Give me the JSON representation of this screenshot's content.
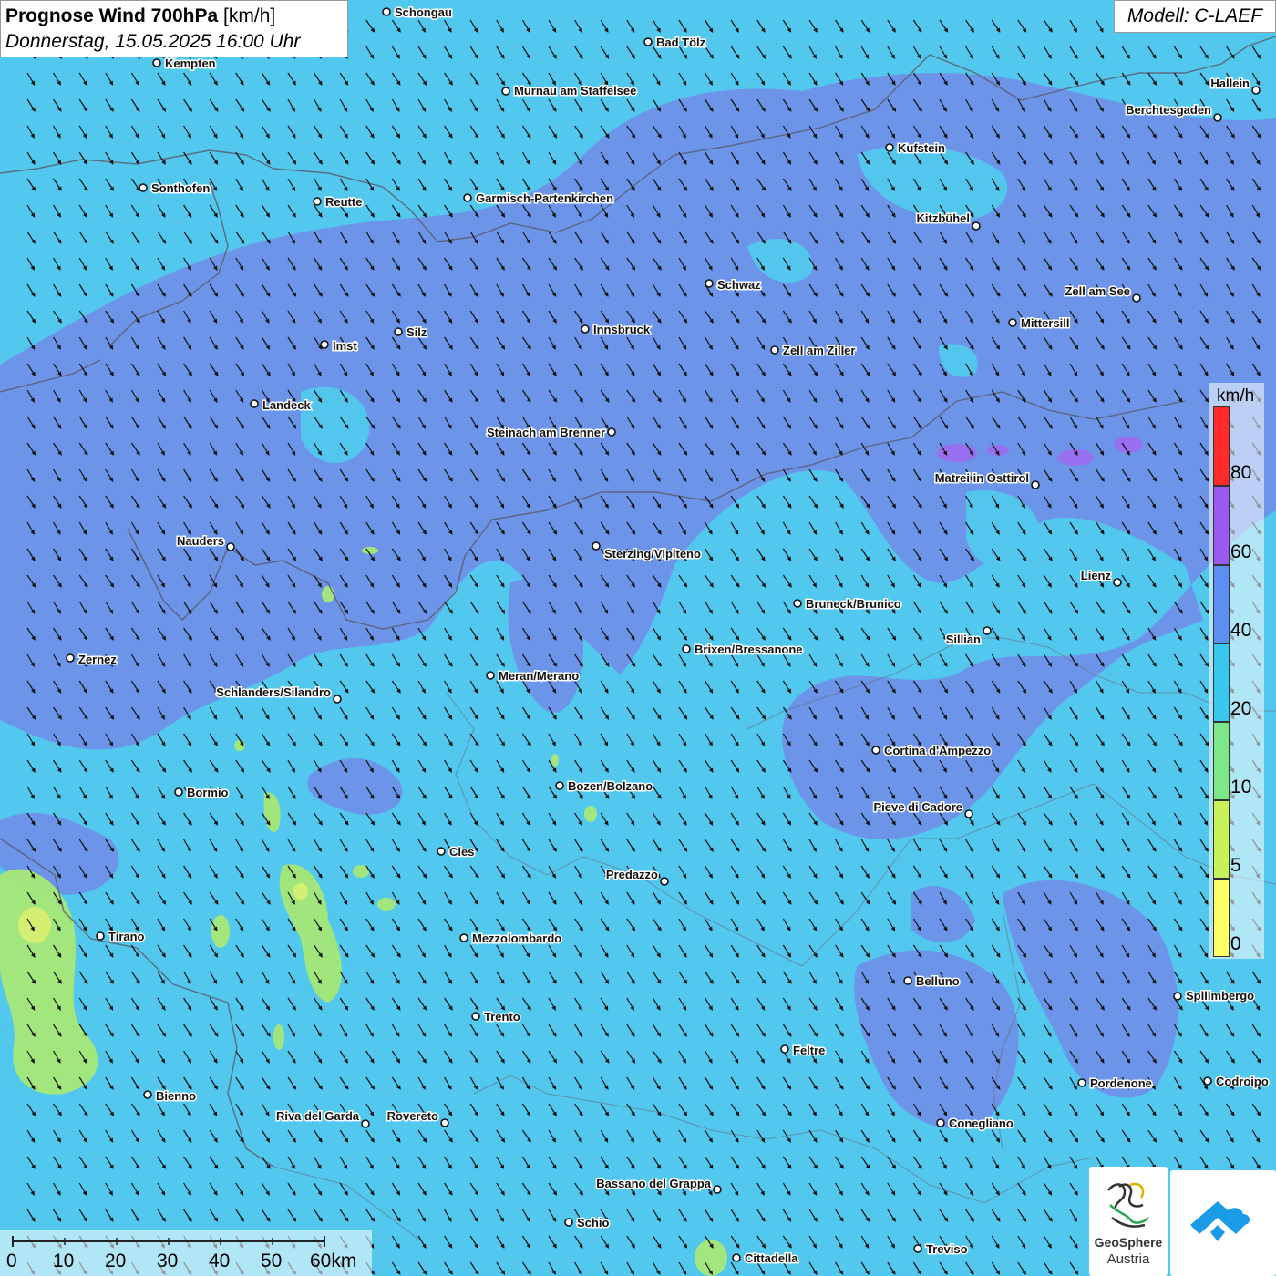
{
  "title": {
    "main_bold": "Prognose Wind 700hPa",
    "main_unit": "[km/h]",
    "datetime": "Donnerstag, 15.05.2025 16:00 Uhr"
  },
  "model_label": "Modell: C-LAEF",
  "legend": {
    "unit": "km/h",
    "ticks": [
      "80",
      "60",
      "40",
      "20",
      "10",
      "5",
      "0"
    ],
    "colors": [
      "#ff2a2a",
      "#9b59f0",
      "#5b8ff2",
      "#38c7ef",
      "#7de88a",
      "#c8f25a",
      "#ffff66"
    ]
  },
  "scale_bar": {
    "ticks": [
      "0",
      "10",
      "20",
      "30",
      "40",
      "50",
      "60km"
    ]
  },
  "logos": {
    "geosphere_line1": "GeoSphere",
    "geosphere_line2": "Austria",
    "icons": [
      "geosphere-logo-icon",
      "weather-app-logo-icon"
    ]
  },
  "wind_field": {
    "arrow_direction": "south-east",
    "dominant_speed_band_kmh": "20-40",
    "colors": {
      "band_20_40": "#52c8ee",
      "band_40_60": "#6f8fe8",
      "band_60_80": "#9b6ef0",
      "band_5_10": "#a6e876",
      "band_0_5": "#e8f070"
    }
  },
  "cities": [
    {
      "name": "Schongau"
    },
    {
      "name": "Bad Tölz"
    },
    {
      "name": "Kempten"
    },
    {
      "name": "Murnau am Staffelsee"
    },
    {
      "name": "Hallein"
    },
    {
      "name": "Berchtesgaden"
    },
    {
      "name": "Kufstein"
    },
    {
      "name": "Sonthofen"
    },
    {
      "name": "Reutte"
    },
    {
      "name": "Garmisch-Partenkirchen"
    },
    {
      "name": "Kitzbühel"
    },
    {
      "name": "Schwaz"
    },
    {
      "name": "Zell am See"
    },
    {
      "name": "Mittersill"
    },
    {
      "name": "Silz"
    },
    {
      "name": "Innsbruck"
    },
    {
      "name": "Imst"
    },
    {
      "name": "Zell am Ziller"
    },
    {
      "name": "Landeck"
    },
    {
      "name": "Steinach am Brenner"
    },
    {
      "name": "Matrei in Osttirol"
    },
    {
      "name": "Nauders"
    },
    {
      "name": "Sterzing/Vipiteno"
    },
    {
      "name": "Lienz"
    },
    {
      "name": "Bruneck/Brunico"
    },
    {
      "name": "Sillian"
    },
    {
      "name": "Zernez"
    },
    {
      "name": "Brixen/Bressanone"
    },
    {
      "name": "Meran/Merano"
    },
    {
      "name": "Schlanders/Silandro"
    },
    {
      "name": "Cortina d'Ampezzo"
    },
    {
      "name": "Bormio"
    },
    {
      "name": "Bozen/Bolzano"
    },
    {
      "name": "Pieve di Cadore"
    },
    {
      "name": "Cles"
    },
    {
      "name": "Predazzo"
    },
    {
      "name": "Tirano"
    },
    {
      "name": "Mezzolombardo"
    },
    {
      "name": "Belluno"
    },
    {
      "name": "Spilimbergo"
    },
    {
      "name": "Trento"
    },
    {
      "name": "Feltre"
    },
    {
      "name": "Bienno"
    },
    {
      "name": "Pordenone"
    },
    {
      "name": "Codroipo"
    },
    {
      "name": "Riva del Garda"
    },
    {
      "name": "Rovereto"
    },
    {
      "name": "Conegliano"
    },
    {
      "name": "Bassano del Grappa"
    },
    {
      "name": "Schio"
    },
    {
      "name": "Treviso"
    },
    {
      "name": "Cittadella"
    }
  ]
}
